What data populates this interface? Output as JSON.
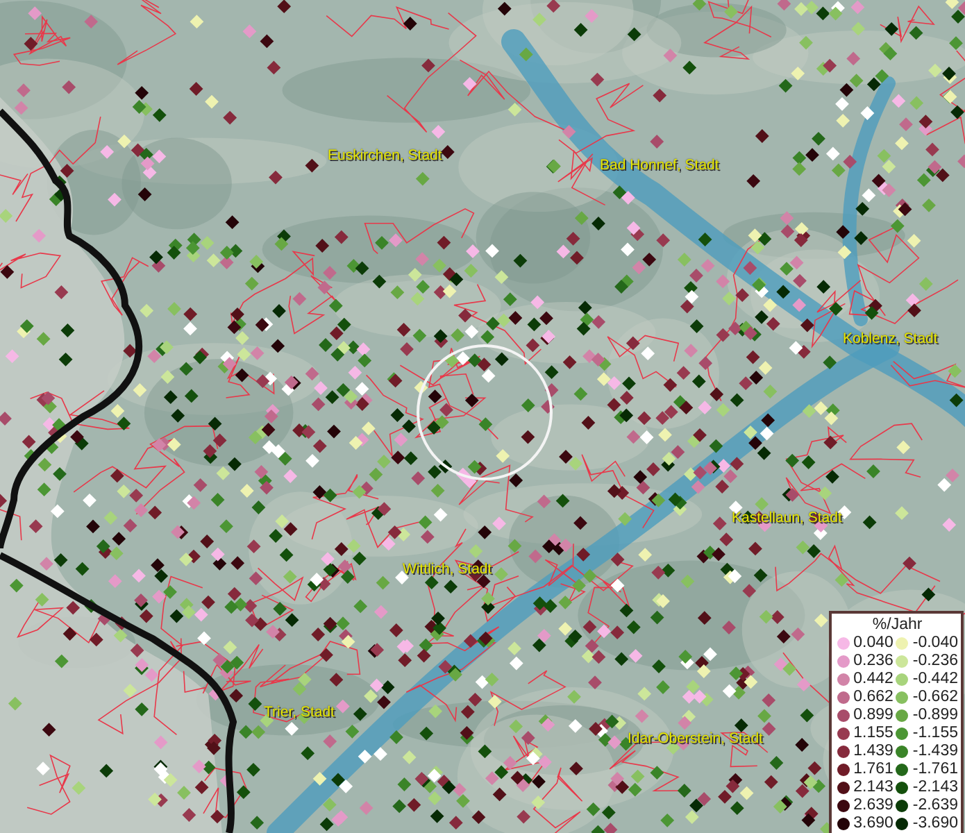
{
  "map": {
    "places": [
      {
        "name": "Euskirchen, Stadt"
      },
      {
        "name": "Bad Honnef, Stadt"
      },
      {
        "name": "Koblenz, Stadt"
      },
      {
        "name": "Kastellaun, Stadt"
      },
      {
        "name": "Wittlich, Stadt"
      },
      {
        "name": "Trier, Stadt"
      },
      {
        "name": "Idar-Oberstein, Stadt"
      }
    ]
  },
  "legend": {
    "title": "%/Jahr",
    "columns": [
      {
        "items": [
          {
            "value": "0.040",
            "color": "#f6b8e6"
          },
          {
            "value": "0.236",
            "color": "#e49ac8"
          },
          {
            "value": "0.442",
            "color": "#d284a8"
          },
          {
            "value": "0.662",
            "color": "#c06a8c"
          },
          {
            "value": "0.899",
            "color": "#a84c6a"
          },
          {
            "value": "1.155",
            "color": "#983a50"
          },
          {
            "value": "1.439",
            "color": "#862a3c"
          },
          {
            "value": "1.761",
            "color": "#701c28"
          },
          {
            "value": "2.143",
            "color": "#521018"
          },
          {
            "value": "2.639",
            "color": "#3c0810"
          },
          {
            "value": "3.690",
            "color": "#240408"
          }
        ]
      },
      {
        "items": [
          {
            "value": "-0.040",
            "color": "#eef2b0"
          },
          {
            "value": "-0.236",
            "color": "#cce69a"
          },
          {
            "value": "-0.442",
            "color": "#a8d47c"
          },
          {
            "value": "-0.662",
            "color": "#88c060"
          },
          {
            "value": "-0.899",
            "color": "#68a844"
          },
          {
            "value": "-1.155",
            "color": "#4c9634"
          },
          {
            "value": "-1.439",
            "color": "#3a8428"
          },
          {
            "value": "-1.761",
            "color": "#24681a"
          },
          {
            "value": "-2.143",
            "color": "#14500c"
          },
          {
            "value": "-2.639",
            "color": "#0c3c08"
          },
          {
            "value": "-3.690",
            "color": "#062a04"
          }
        ]
      }
    ]
  }
}
